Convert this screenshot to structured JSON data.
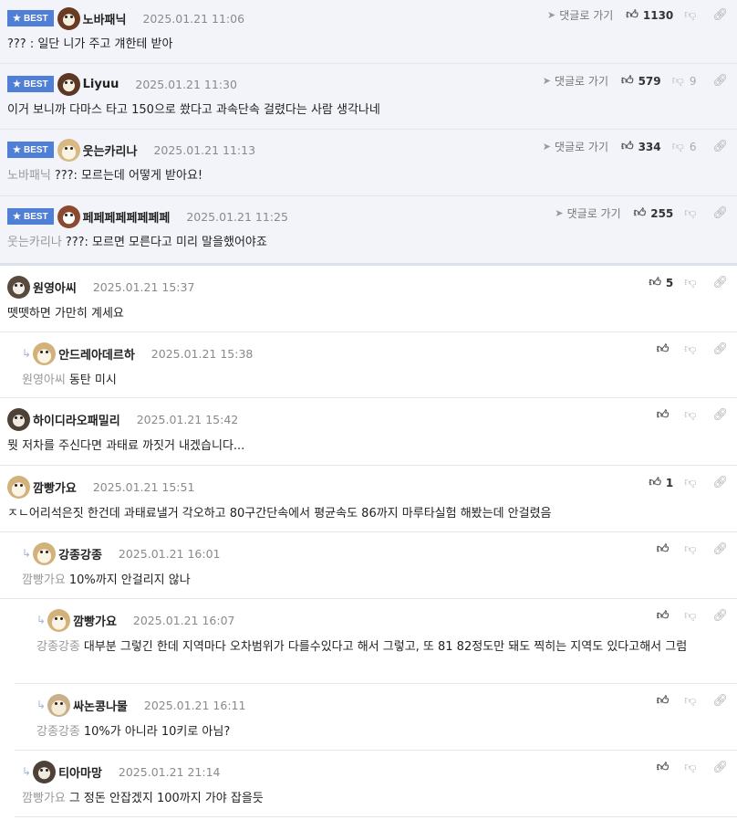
{
  "best_label": "BEST",
  "goto_label": "댓글로 가기",
  "best": [
    {
      "nick": "노바패닉",
      "date": "2025.01.21 11:06",
      "likes": "1130",
      "dislikes": "",
      "quote": "",
      "text": "??? : 일단 니가 주고 걔한테 받아"
    },
    {
      "nick": "Liyuu",
      "date": "2025.01.21 11:30",
      "likes": "579",
      "dislikes": "9",
      "quote": "",
      "text": "이거 보니까 다마스 타고 150으로 쐈다고 과속단속 걸렸다는 사람 생각나네"
    },
    {
      "nick": "웃는카리나",
      "date": "2025.01.21 11:13",
      "likes": "334",
      "dislikes": "6",
      "quote": "노바패닉",
      "text": "???: 모르는데 어떻게 받아요!"
    },
    {
      "nick": "페페페페페페페페",
      "date": "2025.01.21 11:25",
      "likes": "255",
      "dislikes": "",
      "quote": "웃는카리나",
      "text": "???: 모르면 모른다고 미리 말을했어야죠"
    }
  ],
  "comments": [
    {
      "nick": "원영아씨",
      "date": "2025.01.21 15:37",
      "likes": "5",
      "quote": "",
      "text": "뗏뗏하면 가만히 계세요"
    },
    {
      "nick": "안드레아데르하",
      "date": "2025.01.21 15:38",
      "likes": "",
      "quote": "원영아씨",
      "text": "동탄 미시"
    },
    {
      "nick": "하이디라오패밀리",
      "date": "2025.01.21 15:42",
      "likes": "",
      "quote": "",
      "text": "뭣 저차를 주신다면 과태료 까짓거 내겠습니다..."
    },
    {
      "nick": "깜빵가요",
      "date": "2025.01.21 15:51",
      "likes": "1",
      "quote": "",
      "text": "ㅈㄴ어리석은짓 한건데 과태료낼거 각오하고 80구간단속에서 평균속도 86까지 마루타실험 해봤는데 안걸렸음"
    },
    {
      "nick": "강종강종",
      "date": "2025.01.21 16:01",
      "likes": "",
      "quote": "깜빵가요",
      "text": "10%까지 안걸리지 않나"
    },
    {
      "nick": "깜빵가요",
      "date": "2025.01.21 16:07",
      "likes": "",
      "quote": "강종강종",
      "text": "대부분 그렇긴 한데 지역마다 오차범위가 다를수있다고 해서 그렇고, 또 81 82정도만 돼도 찍히는 지역도 있다고해서 그럼"
    },
    {
      "nick": "싸논콩나물",
      "date": "2025.01.21 16:11",
      "likes": "",
      "quote": "강종강종",
      "text": "10%가 아니라 10키로 아님?"
    },
    {
      "nick": "티아마망",
      "date": "2025.01.21 21:14",
      "likes": "",
      "quote": "깜빵가요",
      "text": "그 정돈 안잡겠지 100까지 가야 잡을듯"
    }
  ]
}
